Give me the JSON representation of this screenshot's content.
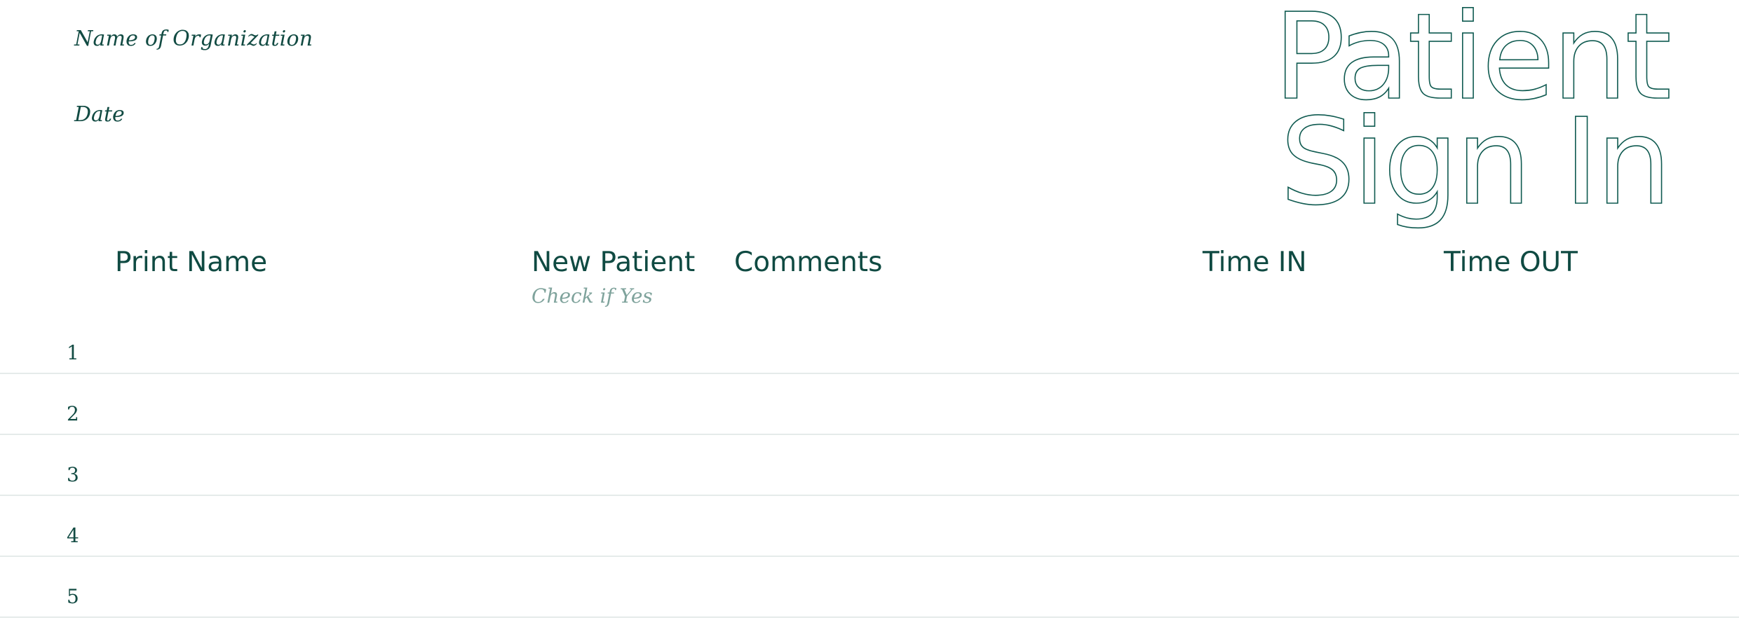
{
  "header": {
    "organization_label": "Name of Organization",
    "date_label": "Date",
    "title_line1": "Patient",
    "title_line2": "Sign In"
  },
  "columns": [
    {
      "label": "Print Name"
    },
    {
      "label": "New Patient",
      "sublabel": "Check if Yes"
    },
    {
      "label": "Comments"
    },
    {
      "label": "Time IN"
    },
    {
      "label": "Time OUT"
    }
  ],
  "rows": [
    {
      "number": "1"
    },
    {
      "number": "2"
    },
    {
      "number": "3"
    },
    {
      "number": "4"
    },
    {
      "number": "5"
    }
  ],
  "colors": {
    "primary": "#0f4a42",
    "muted": "#7fa39c",
    "rule": "#e5ebea"
  }
}
